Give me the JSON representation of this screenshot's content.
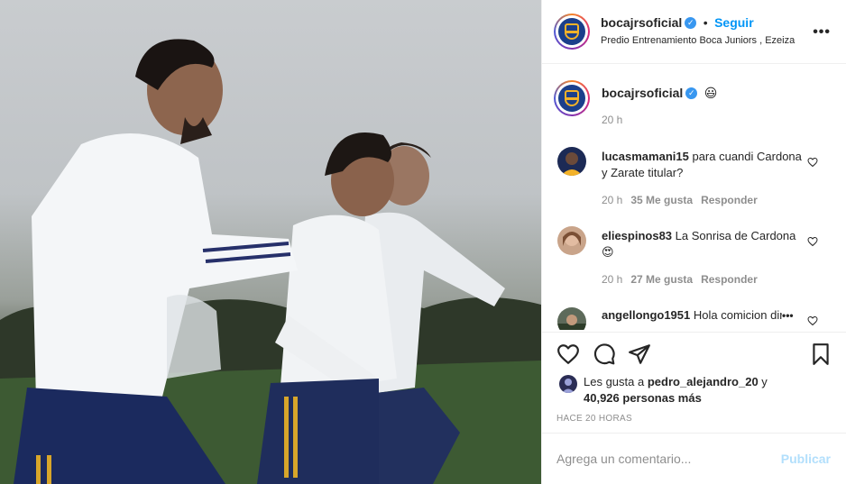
{
  "post": {
    "account": "bocajrsoficial",
    "follow_label": "Seguir",
    "follow_separator": "•",
    "location": "Predio Entrenamiento Boca Juniors , Ezeiza",
    "more_glyph": "•••",
    "verified_glyph": "✓"
  },
  "caption": {
    "username": "bocajrsoficial",
    "emoji": "😃",
    "time": "20 h"
  },
  "comments": [
    {
      "username": "lucasmamani15",
      "text": "para cuandi Cardona y Zarate titular?",
      "time": "20 h",
      "likes": "35 Me gusta",
      "reply": "Responder"
    },
    {
      "username": "eliespinos83",
      "text": "La Sonrisa de Cardona",
      "emoji": "😍",
      "time": "20 h",
      "likes": "27 Me gusta",
      "reply": "Responder"
    },
    {
      "username": "angellongo1951",
      "text": "Hola comicion directiva ..."
    }
  ],
  "actions": {
    "likes_prefix": "Les gusta a",
    "liker": "pedro_alejandro_20",
    "likes_conj": "y",
    "likes_count": "40,926 personas más",
    "ago": "HACE 20 HORAS"
  },
  "composer": {
    "placeholder": "Agrega un comentario...",
    "publish_label": "Publicar"
  },
  "colors": {
    "accent": "#0095f6",
    "verified": "#3897f0",
    "publish_disabled": "#b2dffc",
    "boca_blue": "#1b3f8b",
    "boca_gold": "#f3b229"
  },
  "icons": [
    "heart-icon",
    "comment-icon",
    "share-icon",
    "bookmark-icon",
    "more-icon",
    "verified-icon"
  ]
}
